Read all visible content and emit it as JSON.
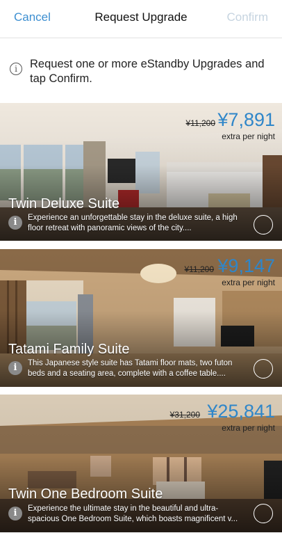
{
  "nav": {
    "cancel": "Cancel",
    "title": "Request Upgrade",
    "confirm": "Confirm",
    "confirm_color": "#c6d4e0",
    "accent": "#3d8fd1"
  },
  "info": {
    "icon": "info-icon",
    "text": "Request one or more eStandby Upgrades and tap Confirm."
  },
  "rooms": [
    {
      "name": "Twin Deluxe Suite",
      "old_price": "¥11,200",
      "price": "¥7,891",
      "per_night": "extra per night",
      "description": "Experience an unforgettable stay in the deluxe suite, a high floor retreat with panoramic views of the city....",
      "selected": false
    },
    {
      "name": "Tatami Family Suite",
      "old_price": "¥11,200",
      "price": "¥9,147",
      "per_night": "extra per night",
      "description": "This Japanese style suite has Tatami floor mats, two futon beds and a seating area, complete with a coffee table....",
      "selected": false
    },
    {
      "name": "Twin One Bedroom Suite",
      "old_price": "¥31,200",
      "price": "¥25,841",
      "per_night": "extra per night",
      "description": "Experience the ultimate stay in the beautiful and ultra-spacious One Bedroom Suite, which boasts magnificent v...",
      "selected": false
    }
  ]
}
